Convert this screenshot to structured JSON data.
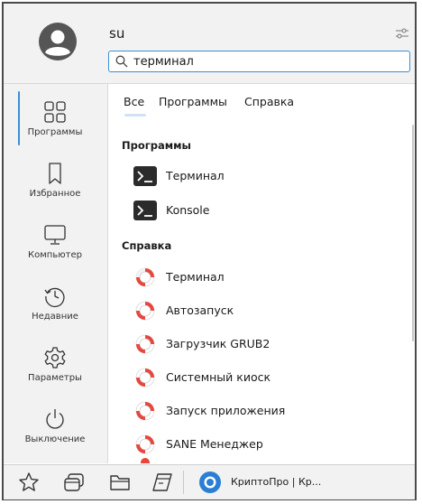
{
  "header": {
    "username": "su",
    "search": {
      "value": "терминал",
      "placeholder": ""
    }
  },
  "sidebar": {
    "items": [
      {
        "label": "Программы",
        "icon": "apps-grid-icon",
        "active": true
      },
      {
        "label": "Избранное",
        "icon": "bookmark-icon",
        "active": false
      },
      {
        "label": "Компьютер",
        "icon": "monitor-icon",
        "active": false
      },
      {
        "label": "Недавние",
        "icon": "recent-clock-icon",
        "active": false
      },
      {
        "label": "Параметры",
        "icon": "gear-icon",
        "active": false
      },
      {
        "label": "Выключение",
        "icon": "power-icon",
        "active": false
      }
    ]
  },
  "tabs": {
    "items": [
      {
        "label": "Все"
      },
      {
        "label": "Программы"
      },
      {
        "label": "Справка"
      }
    ],
    "selected": "Все"
  },
  "results": {
    "programs_title": "Программы",
    "programs": [
      {
        "label": "Терминал",
        "icon": "terminal-icon"
      },
      {
        "label": "Konsole",
        "icon": "terminal-icon"
      }
    ],
    "help_title": "Справка",
    "help": [
      {
        "label": "Терминал",
        "icon": "lifebuoy-icon"
      },
      {
        "label": "Автозапуск",
        "icon": "lifebuoy-icon"
      },
      {
        "label": "Загрузчик GRUB2",
        "icon": "lifebuoy-icon"
      },
      {
        "label": "Системный киоск",
        "icon": "lifebuoy-icon"
      },
      {
        "label": "Запуск приложения",
        "icon": "lifebuoy-icon"
      },
      {
        "label": "SANE Менеджер",
        "icon": "lifebuoy-icon"
      }
    ]
  },
  "taskbar": {
    "task_label": "КриптоПро | Кр...",
    "icons": [
      "star-icon",
      "windows-icon",
      "folder-icon",
      "terminal-window-icon"
    ]
  },
  "colors": {
    "accent": "#3b8fd6",
    "panel": "#f2f2f2",
    "lifebuoy": "#e8453c"
  }
}
